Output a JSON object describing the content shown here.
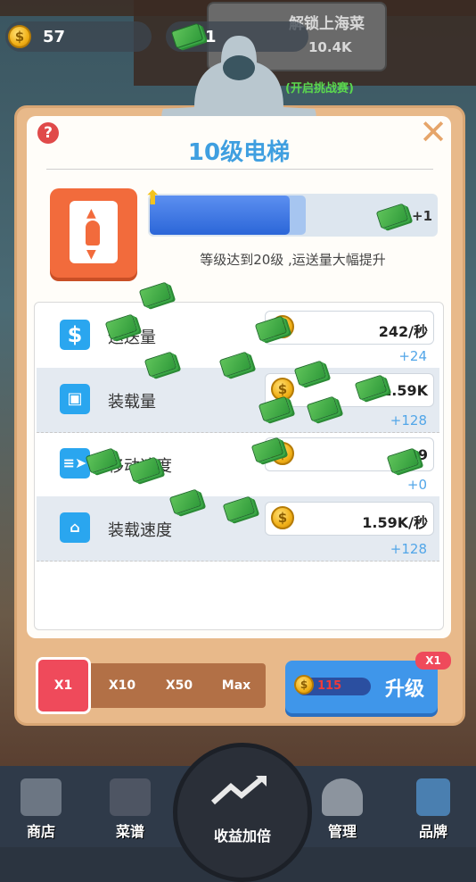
{
  "hud": {
    "coins": "57",
    "cash": "1",
    "unlock_text": "解锁上海菜",
    "unlock_cost": "10.4K",
    "challenge_text": "(开启挑战赛)"
  },
  "panel": {
    "title": "10级电梯",
    "hint": "等级达到20级 ,运送量大幅提升",
    "progress_bonus": "+1",
    "progress_fraction": 0.49
  },
  "stats": [
    {
      "label": "运送量",
      "value": "242/秒",
      "increment": "+24",
      "icon": "dollar-icon"
    },
    {
      "label": "装载量",
      "value": "1.59K",
      "increment": "+128",
      "icon": "box-icon"
    },
    {
      "label": "移动速度",
      "value": "39",
      "increment": "+0",
      "icon": "speed-icon"
    },
    {
      "label": "装载速度",
      "value": "1.59K/秒",
      "increment": "+128",
      "icon": "load-icon"
    }
  ],
  "multipliers": [
    "X1",
    "X10",
    "X50",
    "Max"
  ],
  "upgrade": {
    "label": "升级",
    "cost": "115",
    "badge": "X1"
  },
  "nav": [
    {
      "label": "商店",
      "icon": "shop-icon"
    },
    {
      "label": "菜谱",
      "icon": "recipe-icon"
    },
    {
      "label": "收益加倍",
      "icon": "double-income-icon"
    },
    {
      "label": "管理",
      "icon": "chef-icon"
    },
    {
      "label": "品牌",
      "icon": "building-icon"
    }
  ],
  "colors": {
    "accent": "#3f9fe0",
    "upgrade": "#3f96ea",
    "active": "#ef4a5b",
    "icon_bg": "#f26b3c"
  }
}
